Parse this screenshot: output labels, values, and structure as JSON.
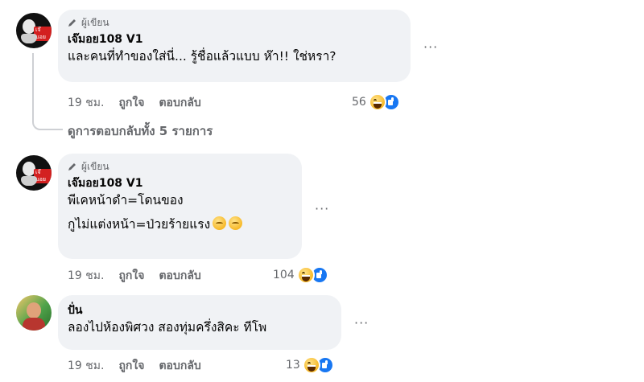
{
  "comments": [
    {
      "badge": "ผู้เขียน",
      "author": "เจ๊มอย108 V1",
      "lines": [
        "และคนที่ทำของใส่นี่... รู้ชื่อแล้วแบบ ห๊า!! ใช่หรา?"
      ],
      "time": "19 ชม.",
      "like_label": "ถูกใจ",
      "reply_label": "ตอบกลับ",
      "reaction_count": "56",
      "reaction_icons": [
        "haha-icon",
        "like-icon"
      ]
    },
    {
      "badge": "ผู้เขียน",
      "author": "เจ๊มอย108 V1",
      "lines": [
        "พีเคหน้าดำ=โดนของ",
        "กูไม่แต่งหน้า=ป่วยร้ายแรง"
      ],
      "time": "19 ชม.",
      "like_label": "ถูกใจ",
      "reply_label": "ตอบกลับ",
      "reaction_count": "104",
      "reaction_icons": [
        "haha-icon",
        "like-icon"
      ]
    },
    {
      "author": "ปั่น",
      "lines": [
        "ลองไปห้องพิศวง สองทุ่มครึ่งสิคะ ทีโพ"
      ],
      "time": "19 ชม.",
      "like_label": "ถูกใจ",
      "reply_label": "ตอบกลับ",
      "reaction_count": "13",
      "reaction_icons": [
        "haha-icon",
        "like-icon"
      ]
    }
  ],
  "view_replies": "ดูการตอบกลับทั้ง 5 รายการ",
  "more_label": "···",
  "avatar_tag": "เจ๊มอย",
  "colors": {
    "bubble": "#f0f2f5",
    "meta": "#65676b",
    "like_blue": "#1877f2",
    "haha_yellow": "#f7b928"
  }
}
